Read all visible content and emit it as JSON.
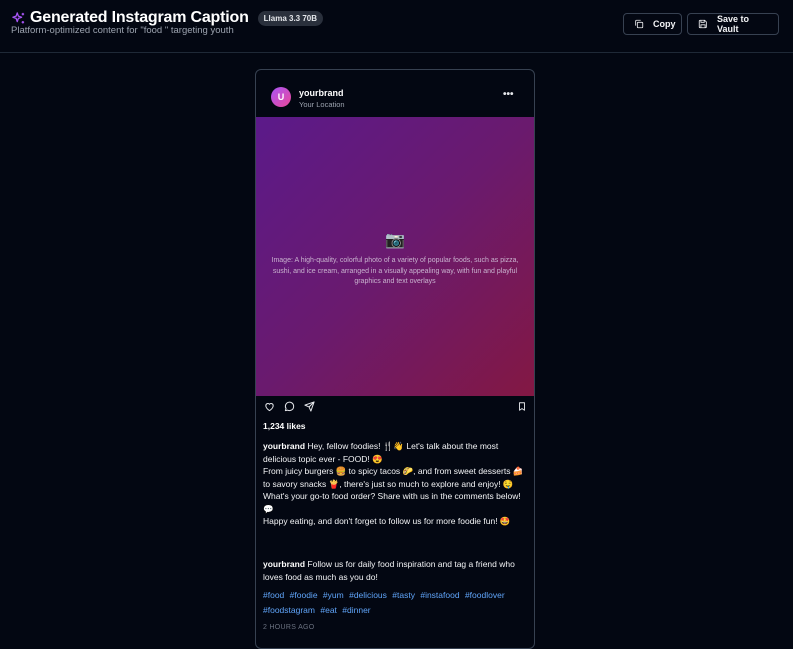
{
  "header": {
    "title": "Generated Instagram Caption",
    "model_badge": "Llama 3.3 70B",
    "subtitle": "Platform-optimized content for \"food \" targeting youth",
    "copy_label": "Copy",
    "save_label": "Save to Vault"
  },
  "post": {
    "avatar_letter": "U",
    "username": "yourbrand",
    "location": "Your Location",
    "more_label": "•••",
    "image_icon": "📷",
    "image_description": "Image: A high-quality, colorful photo of a variety of popular foods, such as pizza, sushi, and ice cream, arranged in a visually appealing way, with fun and playful graphics and text overlays",
    "likes": "1,234 likes",
    "caption_username": "yourbrand",
    "caption_lines": [
      "Hey, fellow foodies! 🍴👋 Let's talk about the most delicious topic ever - FOOD! 😍",
      "From juicy burgers 🍔 to spicy tacos 🌮, and from sweet desserts 🍰 to savory snacks 🍟, there's just so much to explore and enjoy! 🤤",
      "What's your go-to food order? Share with us in the comments below! 💬",
      "Happy eating, and don't forget to follow us for more foodie fun! 🤩"
    ],
    "cta_username": "yourbrand",
    "cta_text": "Follow us for daily food inspiration and tag a friend who loves food as much as you do!",
    "hashtags": [
      "#food",
      "#foodie",
      "#yum",
      "#delicious",
      "#tasty",
      "#instafood",
      "#foodlover",
      "#foodstagram",
      "#eat",
      "#dinner"
    ],
    "time_ago": "2 HOURS AGO"
  },
  "icons": {
    "title": "sparkles-icon",
    "copy": "copy-icon",
    "save": "save-icon",
    "like": "heart-icon",
    "comment": "comment-icon",
    "share": "send-icon",
    "bookmark": "bookmark-icon"
  },
  "colors": {
    "background": "#030712",
    "accent": "#a855f7",
    "hashtag": "#60a5fa",
    "image_gradient_start": "#5b1a8a",
    "image_gradient_end": "#831843"
  }
}
